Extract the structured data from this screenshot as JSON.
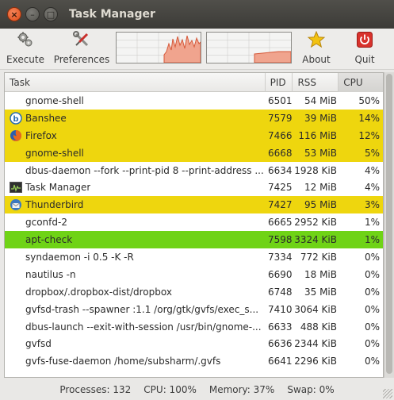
{
  "window": {
    "title": "Task Manager"
  },
  "toolbar": {
    "execute": {
      "label": "Execute",
      "icon": "gears-icon"
    },
    "preferences": {
      "label": "Preferences",
      "icon": "wrench-screwdriver-icon"
    },
    "about": {
      "label": "About",
      "icon": "star-icon"
    },
    "quit": {
      "label": "Quit",
      "icon": "power-icon"
    }
  },
  "columns": {
    "task": "Task",
    "pid": "PID",
    "rss": "RSS",
    "cpu": "CPU"
  },
  "rows": [
    {
      "task": "gnome-shell",
      "pid": "6501",
      "rss": "54 MiB",
      "cpu": "50%",
      "highlight": "none",
      "icon": ""
    },
    {
      "task": "Banshee",
      "pid": "7579",
      "rss": "39 MiB",
      "cpu": "14%",
      "highlight": "#eed60e",
      "icon": "banshee-icon"
    },
    {
      "task": "Firefox",
      "pid": "7466",
      "rss": "116 MiB",
      "cpu": "12%",
      "highlight": "#eed60e",
      "icon": "firefox-icon"
    },
    {
      "task": "gnome-shell",
      "pid": "6668",
      "rss": "53 MiB",
      "cpu": "5%",
      "highlight": "#eed60e",
      "icon": ""
    },
    {
      "task": "dbus-daemon --fork --print-pid 8 --print-address ...",
      "pid": "6634",
      "rss": "1928 KiB",
      "cpu": "4%",
      "highlight": "none",
      "icon": ""
    },
    {
      "task": "Task Manager",
      "pid": "7425",
      "rss": "12 MiB",
      "cpu": "4%",
      "highlight": "none",
      "icon": "task-manager-icon"
    },
    {
      "task": "Thunderbird",
      "pid": "7427",
      "rss": "95 MiB",
      "cpu": "3%",
      "highlight": "#eed60e",
      "icon": "thunderbird-icon"
    },
    {
      "task": "gconfd-2",
      "pid": "6665",
      "rss": "2952 KiB",
      "cpu": "1%",
      "highlight": "none",
      "icon": ""
    },
    {
      "task": "apt-check",
      "pid": "7598",
      "rss": "3324 KiB",
      "cpu": "1%",
      "highlight": "#6fd316",
      "icon": ""
    },
    {
      "task": "syndaemon -i 0.5 -K -R",
      "pid": "7334",
      "rss": "772 KiB",
      "cpu": "0%",
      "highlight": "none",
      "icon": ""
    },
    {
      "task": "nautilus -n",
      "pid": "6690",
      "rss": "18 MiB",
      "cpu": "0%",
      "highlight": "none",
      "icon": ""
    },
    {
      "task": "dropbox/.dropbox-dist/dropbox",
      "pid": "6748",
      "rss": "35 MiB",
      "cpu": "0%",
      "highlight": "none",
      "icon": ""
    },
    {
      "task": "gvfsd-trash --spawner :1.1 /org/gtk/gvfs/exec_s...",
      "pid": "7410",
      "rss": "3064 KiB",
      "cpu": "0%",
      "highlight": "none",
      "icon": ""
    },
    {
      "task": "dbus-launch --exit-with-session /usr/bin/gnome-...",
      "pid": "6633",
      "rss": "488 KiB",
      "cpu": "0%",
      "highlight": "none",
      "icon": ""
    },
    {
      "task": "gvfsd",
      "pid": "6636",
      "rss": "2344 KiB",
      "cpu": "0%",
      "highlight": "none",
      "icon": ""
    },
    {
      "task": "gvfs-fuse-daemon /home/subsharm/.gvfs",
      "pid": "6641",
      "rss": "2296 KiB",
      "cpu": "0%",
      "highlight": "none",
      "icon": ""
    }
  ],
  "status": {
    "processes": "Processes: 132",
    "cpu": "CPU: 100%",
    "memory": "Memory: 37%",
    "swap": "Swap: 0%"
  },
  "colors": {
    "running_highlight": "#eed60e",
    "new_highlight": "#6fd316",
    "graph_fill": "#f0a48e",
    "graph_line": "#d6593a"
  }
}
